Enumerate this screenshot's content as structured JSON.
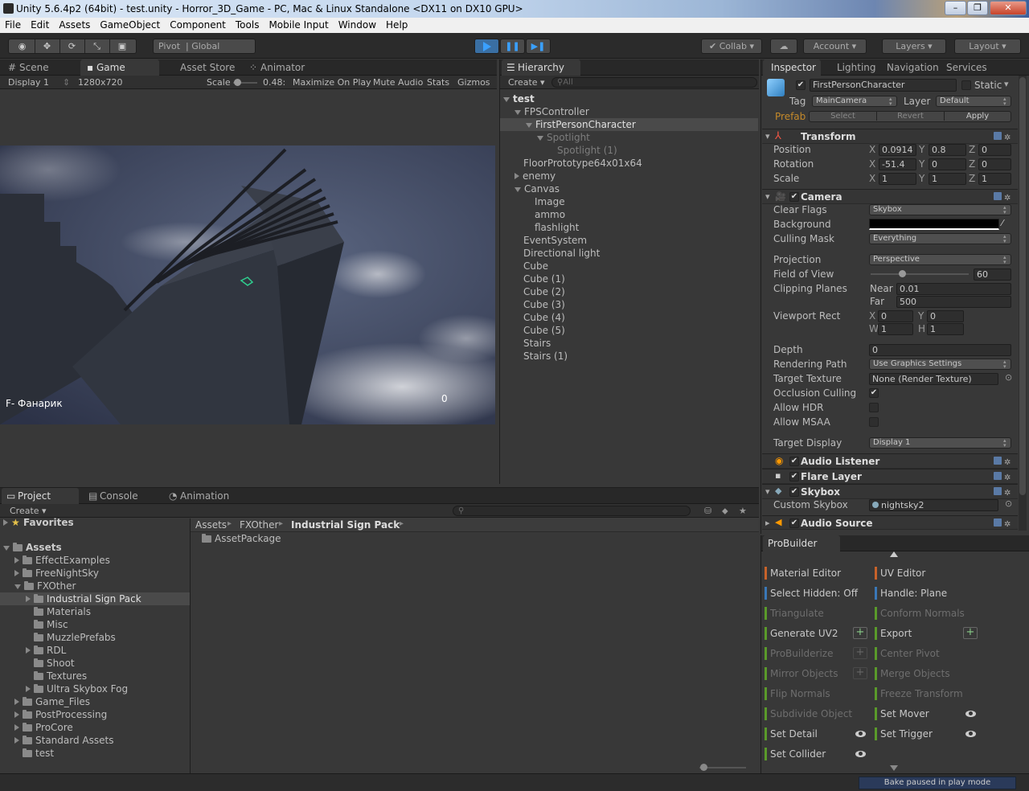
{
  "window": {
    "title": "Unity 5.6.4p2 (64bit) - test.unity - Horror_3D_Game - PC, Mac & Linux Standalone <DX11 on DX10 GPU>"
  },
  "menu": [
    "File",
    "Edit",
    "Assets",
    "GameObject",
    "Component",
    "Tools",
    "Mobile Input",
    "Window",
    "Help"
  ],
  "toolbar": {
    "pivot": "Pivot",
    "global": "Global",
    "collab": "Collab",
    "account": "Account",
    "layers": "Layers",
    "layout": "Layout"
  },
  "game_panel": {
    "tabs": [
      "Scene",
      "Game",
      "Asset Store",
      "Animator"
    ],
    "display": "Display 1",
    "resolution": "1280x720",
    "scale_label": "Scale",
    "scale_value": "0.48:",
    "maximize": "Maximize On Play",
    "mute": "Mute Audio",
    "stats": "Stats",
    "gizmos": "Gizmos",
    "hud_left": "F- Фанарик",
    "hud_right": "0"
  },
  "hierarchy": {
    "tab": "Hierarchy",
    "create": "Create",
    "search_placeholder": "All",
    "scene": "test",
    "items": [
      "FPSController",
      "FirstPersonCharacter",
      "Spotlight",
      "Spotlight (1)",
      "FloorPrototype64x01x64",
      "enemy",
      "Canvas",
      "Image",
      "ammo",
      "flashlight",
      "EventSystem",
      "Directional light",
      "Cube",
      "Cube (1)",
      "Cube (2)",
      "Cube (3)",
      "Cube (4)",
      "Cube (5)",
      "Stairs",
      "Stairs (1)"
    ]
  },
  "inspector": {
    "tabs": [
      "Inspector",
      "Lighting",
      "Navigation",
      "Services"
    ],
    "object_name": "FirstPersonCharacter",
    "static": "Static",
    "tag_label": "Tag",
    "tag": "MainCamera",
    "layer_label": "Layer",
    "layer": "Default",
    "prefab": "Prefab",
    "select": "Select",
    "revert": "Revert",
    "apply": "Apply",
    "transform": {
      "title": "Transform",
      "position": "Position",
      "rotation": "Rotation",
      "scale": "Scale",
      "pos": [
        "0.0914",
        "0.8",
        "0"
      ],
      "rot": [
        "-51.4",
        "0",
        "0"
      ],
      "scl": [
        "1",
        "1",
        "1"
      ]
    },
    "camera": {
      "title": "Camera",
      "clear_flags": "Clear Flags",
      "clear_flags_val": "Skybox",
      "background": "Background",
      "culling_mask": "Culling Mask",
      "culling_mask_val": "Everything",
      "projection": "Projection",
      "projection_val": "Perspective",
      "fov": "Field of View",
      "fov_val": "60",
      "clipping": "Clipping Planes",
      "near": "Near",
      "near_val": "0.01",
      "far": "Far",
      "far_val": "500",
      "viewport": "Viewport Rect",
      "vx": "0",
      "vy": "0",
      "vw": "1",
      "vh": "1",
      "depth": "Depth",
      "depth_val": "0",
      "rendering_path": "Rendering Path",
      "rendering_path_val": "Use Graphics Settings",
      "target_texture": "Target Texture",
      "target_texture_val": "None (Render Texture)",
      "occlusion": "Occlusion Culling",
      "allow_hdr": "Allow HDR",
      "allow_msaa": "Allow MSAA",
      "target_display": "Target Display",
      "target_display_val": "Display 1"
    },
    "audio_listener": "Audio Listener",
    "flare_layer": "Flare Layer",
    "skybox": {
      "title": "Skybox",
      "custom": "Custom Skybox",
      "custom_val": "nightsky2"
    },
    "audio_source": "Audio Source"
  },
  "probuilder": {
    "tab": "ProBuilder",
    "left": [
      "Material Editor",
      "Select Hidden: Off",
      "Triangulate",
      "Generate UV2",
      "ProBuilderize",
      "Mirror Objects",
      "Flip Normals",
      "Subdivide Object",
      "Set Detail",
      "Set Collider"
    ],
    "right": [
      "UV Editor",
      "Handle: Plane",
      "Conform Normals",
      "Export",
      "Center Pivot",
      "Merge Objects",
      "Freeze Transform",
      "Set Mover",
      "Set Trigger"
    ]
  },
  "project": {
    "tabs": [
      "Project",
      "Console",
      "Animation"
    ],
    "create": "Create",
    "favorites": "Favorites",
    "assets": "Assets",
    "tree": [
      "EffectExamples",
      "FreeNightSky",
      "FXOther",
      "Industrial Sign Pack",
      "Materials",
      "Misc",
      "MuzzlePrefabs",
      "RDL",
      "Shoot",
      "Textures",
      "Ultra Skybox Fog",
      "Game_Files",
      "PostProcessing",
      "ProCore",
      "Standard Assets",
      "test"
    ],
    "breadcrumb": [
      "Assets",
      "FXOther",
      "Industrial Sign Pack"
    ],
    "content": [
      "AssetPackage"
    ]
  },
  "statusbar": {
    "bake": "Bake paused in play mode"
  },
  "colors": {
    "accent": "#3a6fa3",
    "selected": "#3e5f87",
    "pb_orange": "#c8622a",
    "pb_blue": "#3a78b8",
    "pb_green": "#5a9a2a"
  }
}
